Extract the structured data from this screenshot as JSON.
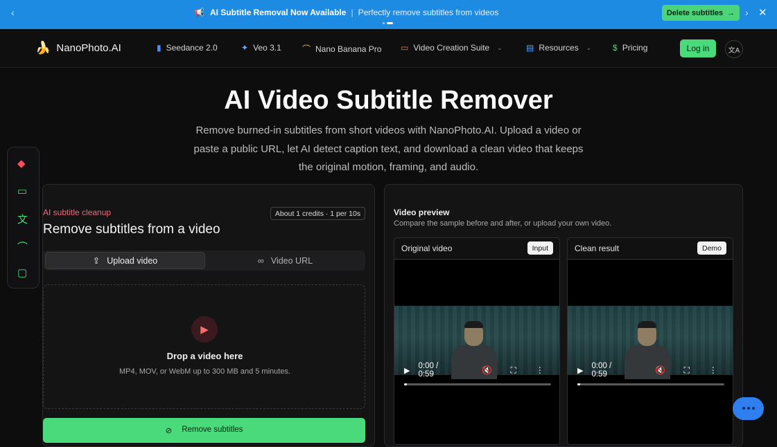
{
  "announcement": {
    "title": "AI Subtitle Removal Now Available",
    "separator": "|",
    "subtitle": "Perfectly remove subtitles from videos",
    "cta_label": "Delete subtitles",
    "prev_glyph": "‹",
    "next_glyph": "›",
    "close_glyph": "✕",
    "megaphone_glyph": "📢",
    "cta_arrow": "→"
  },
  "nav": {
    "brand": "NanoPhoto.AI",
    "brand_icon": "🍌",
    "items": [
      {
        "label": "Seedance 2.0",
        "icon": "bar-chart-icon",
        "glyph": "▮"
      },
      {
        "label": "Veo 3.1",
        "icon": "sparkle-icon",
        "glyph": "✦"
      },
      {
        "label": "Nano Banana Pro",
        "icon": "banana-icon",
        "glyph": "⌒"
      },
      {
        "label": "Video Creation Suite",
        "icon": "video-camera-icon",
        "glyph": "▭",
        "chevron": "⌄"
      },
      {
        "label": "Resources",
        "icon": "document-icon",
        "glyph": "▤",
        "chevron": "⌄"
      },
      {
        "label": "Pricing",
        "icon": "dollar-icon",
        "glyph": "$"
      }
    ],
    "login_label": "Log in",
    "lang_glyph": "文A"
  },
  "hero": {
    "title": "AI Video Subtitle Remover",
    "description": "Remove burned-in subtitles from short videos with NanoPhoto.AI. Upload a video or paste a public URL, let AI detect caption text, and download a clean video that keeps the original motion, framing, and audio."
  },
  "dock": {
    "items": [
      {
        "icon": "ai-robot-icon",
        "glyph": "◆",
        "color": "#ff4d5e"
      },
      {
        "icon": "video-camera-icon",
        "glyph": "▭",
        "color": "#4ad97b"
      },
      {
        "icon": "translate-icon",
        "glyph": "文",
        "color": "#4ad97b"
      },
      {
        "icon": "banana-icon",
        "glyph": "⌒",
        "color": "#4ad97b"
      },
      {
        "icon": "monitor-icon",
        "glyph": "▢",
        "color": "#4ad97b"
      }
    ]
  },
  "tool": {
    "tag": "AI subtitle cleanup",
    "credits": "About 1 credits · 1 per 10s",
    "title": "Remove subtitles from a video",
    "tabs": [
      {
        "label": "Upload video",
        "glyph": "⇪"
      },
      {
        "label": "Video URL",
        "glyph": "∞"
      }
    ],
    "drop_title": "Drop a video here",
    "drop_sub": "MP4, MOV, or WebM up to 300 MB and 5 minutes.",
    "drop_glyph": "▶",
    "submit_label": "Remove subtitles",
    "submit_glyph": "⊘"
  },
  "preview": {
    "title": "Video preview",
    "subtitle": "Compare the sample before and after, or upload your own video.",
    "videos": [
      {
        "label": "Original video",
        "badge": "Input",
        "time": "0:00 / 0:59",
        "progress": 0.0
      },
      {
        "label": "Clean result",
        "badge": "Demo",
        "time": "0:00 / 0:59",
        "progress": 0.0
      }
    ],
    "play_glyph": "▶",
    "mute_glyph": "🔇",
    "fullscreen_glyph": "⛶",
    "more_glyph": "⋮"
  },
  "colors": {
    "accent_green": "#4ad97b",
    "announcement_blue": "#1e8be3",
    "tag_pink": "#f0677f",
    "chat_blue": "#2f7ff0"
  }
}
